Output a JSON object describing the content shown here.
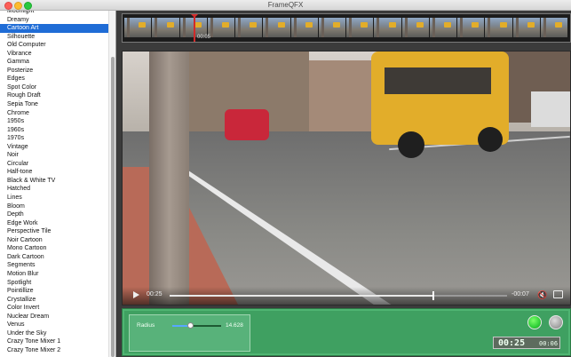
{
  "window": {
    "title": "FrameQFX"
  },
  "colors": {
    "selection": "#1f6cd6",
    "panel_green": "#3fa061",
    "playhead": "#d12a2a"
  },
  "filters": {
    "selected_index": 2,
    "items": [
      "Moonlight",
      "Dreamy",
      "Cartoon Art",
      "Silhouette",
      "Old Computer",
      "Vibrance",
      "Gamma",
      "Posterize",
      "Edges",
      "Spot Color",
      "Rough Draft",
      "Sepia Tone",
      "Chrome",
      "1950s",
      "1960s",
      "1970s",
      "Vintage",
      "Noir",
      "Circular",
      "Half-tone",
      "Black & White TV",
      "Hatched",
      "Lines",
      "Bloom",
      "Depth",
      "Edge Work",
      "Perspective Tile",
      "Noir Cartoon",
      "Mono Cartoon",
      "Dark Cartoon",
      "Segments",
      "Motion Blur",
      "Spotlight",
      "Pointillize",
      "Crystallize",
      "Color Invert",
      "Nuclear Dream",
      "Venus",
      "Under the Sky",
      "Crazy Tone Mixer 1",
      "Crazy Tone Mixer 2"
    ]
  },
  "timeline": {
    "playhead_time": "00:05"
  },
  "player": {
    "current_time": "00:25",
    "remaining_time": "-00:07",
    "progress_fraction": 0.78,
    "play_icon": "play-icon",
    "mute_icon": "muted-speaker-icon",
    "airplay_icon": "airplay-icon"
  },
  "params": {
    "label": "Radius",
    "value": "14.628",
    "fraction": 0.38
  },
  "timecode": {
    "main": "00:25",
    "sub": "00:06"
  }
}
